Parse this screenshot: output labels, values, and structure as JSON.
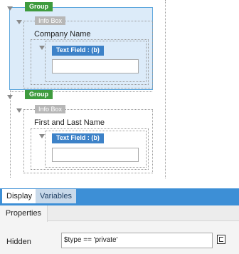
{
  "canvas": {
    "group1": {
      "tag": "Group",
      "info_box_tag": "Info Box",
      "label": "Company Name",
      "field_tag": "Text Field : (b)"
    },
    "group2": {
      "tag": "Group",
      "info_box_tag": "Info Box",
      "label": "First and Last Name",
      "field_tag": "Text Field : (b)"
    }
  },
  "tabs": [
    {
      "label": "Display",
      "active": true
    },
    {
      "label": "Variables",
      "active": false
    }
  ],
  "properties": {
    "tab_label": "Properties",
    "hidden_label": "Hidden",
    "hidden_value": "$type == 'private'",
    "editor_icon": "expression-editor-icon"
  },
  "colors": {
    "selected_fill": "#dcebf9",
    "selected_border": "#5ea7dd",
    "group_tag": "#3e9b3e",
    "field_tag": "#3d82c8",
    "tabbar": "#3d8fd6"
  }
}
